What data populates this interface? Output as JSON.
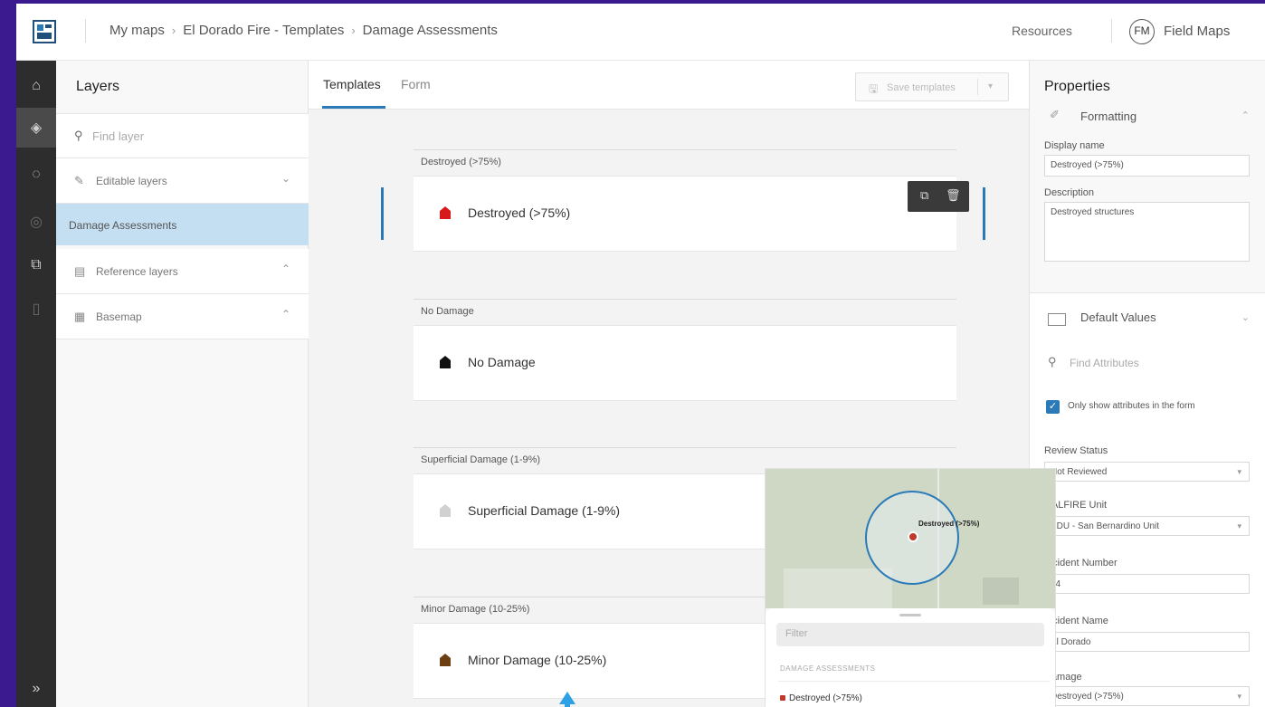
{
  "header": {
    "breadcrumbs": [
      "My maps",
      "El Dorado Fire - Templates",
      "Damage Assessments"
    ],
    "breadcrumb_sep": "›",
    "resources": "Resources",
    "avatar_initials": "FM",
    "app_name": "Field Maps"
  },
  "rail": {
    "items": [
      "home-icon",
      "layers-icon",
      "map-icon",
      "dim-icon",
      "share-icon",
      "device-icon"
    ],
    "expand": "»"
  },
  "layers": {
    "title": "Layers",
    "search_placeholder": "Find layer",
    "groups": [
      {
        "label": "Editable layers",
        "chevron": "⌄"
      },
      {
        "label": "Reference layers",
        "chevron": "⌃"
      },
      {
        "label": "Basemap",
        "chevron": "⌃"
      }
    ],
    "selected_layer": "Damage Assessments"
  },
  "templates": {
    "tabs": [
      "Templates",
      "Form"
    ],
    "save_label": "Save templates",
    "groups": [
      {
        "header": "Destroyed (>75%)",
        "label": "Destroyed (>75%)",
        "color": "#d7191c"
      },
      {
        "header": "No Damage",
        "label": "No Damage",
        "color": "#111111"
      },
      {
        "header": "Superficial Damage (1-9%)",
        "label": "Superficial Damage (1-9%)",
        "color": "#d0d0d0"
      },
      {
        "header": "Minor Damage (10-25%)",
        "label": "Minor Damage (10-25%)",
        "color": "#6b3f12"
      }
    ]
  },
  "properties": {
    "title": "Properties",
    "formatting_label": "Formatting",
    "display_name_label": "Display name",
    "display_name_value": "Destroyed (>75%)",
    "description_label": "Description",
    "description_value": "Destroyed structures",
    "default_values_label": "Default Values",
    "find_attributes_placeholder": "Find Attributes",
    "only_show_label": "Only show attributes in the form",
    "review_status_label": "Review Status",
    "review_status_value": "Not Reviewed",
    "calfire_label": "CALFIRE Unit",
    "calfire_value": "BDU - San Bernardino Unit",
    "incident_number_label": "Incident Number",
    "incident_number_value": "74",
    "incident_name_label": "Incident Name",
    "incident_name_value": "El Dorado",
    "damage_label": "Damage",
    "damage_value": "Destroyed (>75%)"
  },
  "preview": {
    "map_label": "Destroyed (>75%)",
    "filter_placeholder": "Filter",
    "section_title": "DAMAGE ASSESSMENTS",
    "item_label": "Destroyed (>75%)"
  },
  "colors": {
    "accent": "#2a7ab8",
    "frame": "#3b1a8f",
    "arrow": "#2ea0e6"
  }
}
